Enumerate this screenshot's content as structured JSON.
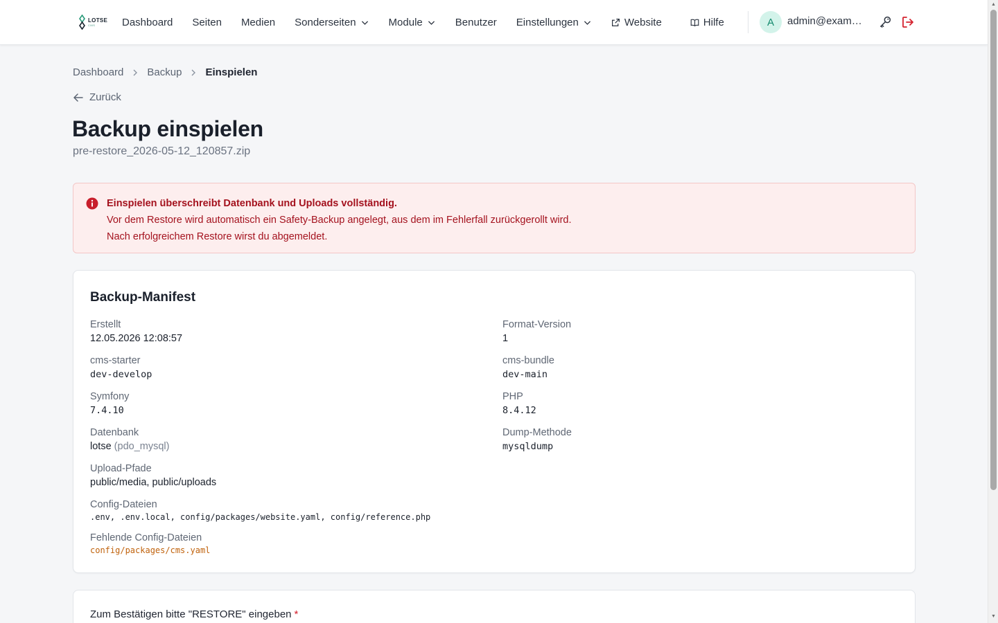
{
  "brand": {
    "name": "LOTSE",
    "sub": "CMS"
  },
  "nav": {
    "dashboard": "Dashboard",
    "seiten": "Seiten",
    "medien": "Medien",
    "sonderseiten": "Sonderseiten",
    "module": "Module",
    "benutzer": "Benutzer",
    "einstellungen": "Einstellungen",
    "website": "Website",
    "hilfe": "Hilfe"
  },
  "user": {
    "initial": "A",
    "email": "admin@example.com"
  },
  "breadcrumb": {
    "items": [
      "Dashboard",
      "Backup"
    ],
    "current": "Einspielen"
  },
  "back_label": "Zurück",
  "page": {
    "title": "Backup einspielen",
    "subtitle": "pre-restore_2026-05-12_120857.zip"
  },
  "alert": {
    "headline": "Einspielen überschreibt Datenbank und Uploads vollständig.",
    "line1": "Vor dem Restore wird automatisch ein Safety-Backup angelegt, aus dem im Fehlerfall zurückgerollt wird.",
    "line2": "Nach erfolgreichem Restore wirst du abgemeldet."
  },
  "manifest": {
    "title": "Backup-Manifest",
    "erstellt": {
      "label": "Erstellt",
      "value": "12.05.2026 12:08:57"
    },
    "format_version": {
      "label": "Format-Version",
      "value": "1"
    },
    "cms_starter": {
      "label": "cms-starter",
      "value": "dev-develop"
    },
    "cms_bundle": {
      "label": "cms-bundle",
      "value": "dev-main"
    },
    "symfony": {
      "label": "Symfony",
      "value": "7.4.10"
    },
    "php": {
      "label": "PHP",
      "value": "8.4.12"
    },
    "datenbank": {
      "label": "Datenbank",
      "value": "lotse",
      "driver": "(pdo_mysql)"
    },
    "dump_methode": {
      "label": "Dump-Methode",
      "value": "mysqldump"
    },
    "upload_pfade": {
      "label": "Upload-Pfade",
      "value": "public/media, public/uploads"
    },
    "config_dateien": {
      "label": "Config-Dateien",
      "value": ".env, .env.local, config/packages/website.yaml, config/reference.php"
    },
    "fehlende_config": {
      "label": "Fehlende Config-Dateien",
      "value": "config/packages/cms.yaml"
    }
  },
  "confirm": {
    "label": "Zum Bestätigen bitte \"RESTORE\" eingeben",
    "required_mark": "*"
  },
  "colors": {
    "accent": "#158a6e",
    "danger": "#a4121e",
    "warning": "#c0620c"
  }
}
